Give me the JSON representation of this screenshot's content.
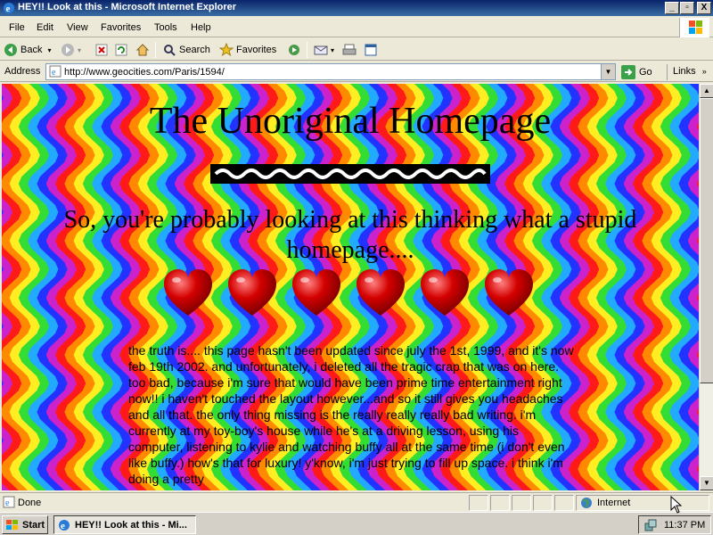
{
  "window": {
    "title": "HEY!! Look at this - Microsoft Internet Explorer",
    "controls": [
      "_",
      "▫",
      "X"
    ]
  },
  "menu": [
    "File",
    "Edit",
    "View",
    "Favorites",
    "Tools",
    "Help"
  ],
  "toolbar": {
    "back": "Back",
    "search": "Search",
    "favorites": "Favorites"
  },
  "address": {
    "label": "Address",
    "url": "http://www.geocities.com/Paris/1594/",
    "go": "Go",
    "links": "Links"
  },
  "page": {
    "heading": "The Unoriginal Homepage",
    "subheading": "So, you're probably looking at this thinking what a stupid homepage....",
    "body": "the truth is.... this page hasn't been updated since july the 1st, 1999, and it's now feb 19th 2002. and unfortunately, i deleted all the tragic crap that was on here. too bad, because i'm sure that would have been prime time entertainment right now!! i haven't touched the layout however...and so it still gives you headaches and all that. the only thing missing is the really really really bad writing. i'm currently at my toy-boy's house while he's at a driving lesson, using his computer, listening to kylie and watching buffy all at the same time (i don't even like buffy.) how's that for luxury! y'know, i'm just trying to fill up space. i think i'm doing a pretty",
    "heart_count": 6
  },
  "status": {
    "text": "Done",
    "zone": "Internet"
  },
  "taskbar": {
    "start": "Start",
    "task": "HEY!! Look at this - Mi...",
    "time": "11:37 PM"
  },
  "colors": {
    "titlebar": "#0a246a",
    "chrome": "#ece9d8",
    "heart": "#d40000"
  }
}
